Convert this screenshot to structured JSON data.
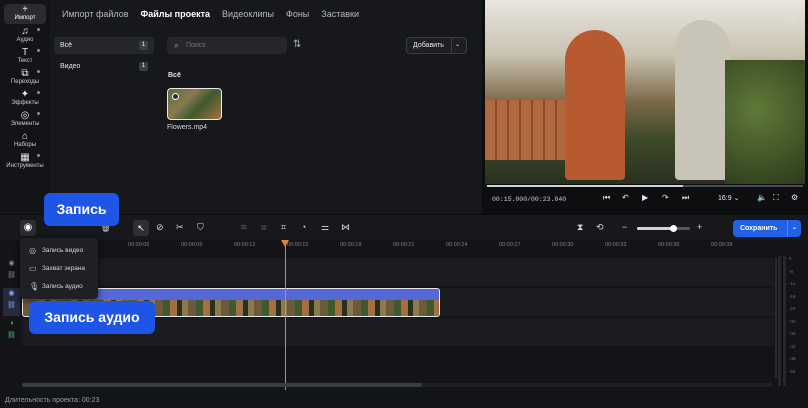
{
  "rail": {
    "items": [
      {
        "label": "Импорт",
        "icon": "plus-icon",
        "glyph": "+"
      },
      {
        "label": "Аудио",
        "icon": "music-note-icon",
        "glyph": "♫"
      },
      {
        "label": "Текст",
        "icon": "text-icon",
        "glyph": "T"
      },
      {
        "label": "Переходы",
        "icon": "transitions-icon",
        "glyph": "⧉"
      },
      {
        "label": "Эффекты",
        "icon": "sparkle-icon",
        "glyph": "✦"
      },
      {
        "label": "Элементы",
        "icon": "elements-icon",
        "glyph": "◎"
      },
      {
        "label": "Наборы",
        "icon": "package-icon",
        "glyph": "⌂"
      },
      {
        "label": "Инструменты",
        "icon": "tools-icon",
        "glyph": "▦"
      }
    ]
  },
  "library": {
    "tabs": [
      "Импорт файлов",
      "Файлы проекта",
      "Видеоклипы",
      "Фоны",
      "Заставки"
    ],
    "active_tab": 1,
    "folders": [
      {
        "label": "Всё",
        "count": "1"
      },
      {
        "label": "Видео",
        "count": "1"
      }
    ],
    "search_placeholder": "Поиск",
    "add_label": "Добавить",
    "group_label": "Всё",
    "file_name": "Flowers.mp4"
  },
  "preview": {
    "time_current": "00:15.000",
    "time_separator": "/",
    "time_total": "00:23.840",
    "aspect": "16:9",
    "progress": 0.62
  },
  "toolbar": {
    "save_label": "Сохранить"
  },
  "timeline": {
    "ticks": [
      "00:00:06",
      "00:00:09",
      "00:00:12",
      "00:00:15",
      "00:00:18",
      "00:00:21",
      "00:00:24",
      "00:00:27",
      "00:00:30",
      "00:00:33",
      "00:00:36",
      "00:00:39"
    ],
    "meter_labels": [
      "0",
      "-6",
      "-12",
      "-18",
      "-24",
      "-30",
      "-36",
      "-42",
      "-48",
      "-54"
    ],
    "duration_label": "Длительность проекта: 00:23"
  },
  "menu": {
    "items": [
      {
        "label": "Запись видео",
        "icon": "webcam-icon"
      },
      {
        "label": "Захват экрана",
        "icon": "monitor-icon"
      },
      {
        "label": "Запись аудио",
        "icon": "microphone-icon"
      }
    ]
  },
  "callouts": {
    "record": "Запись",
    "record_audio": "Запись аудио"
  },
  "colors": {
    "accent": "#1f62e8",
    "callout": "#1f55e6",
    "playhead": "#e8803a"
  }
}
